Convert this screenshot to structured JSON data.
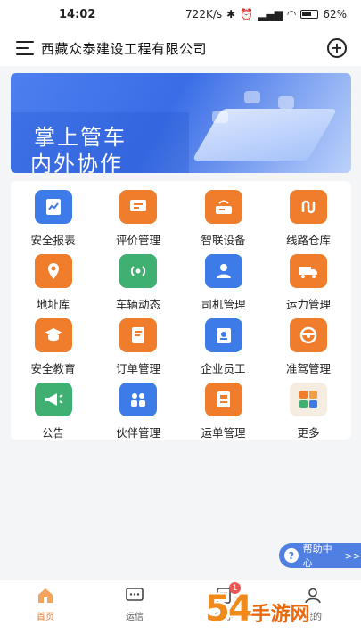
{
  "status_bar": {
    "time": "14:02",
    "speed": "722K/s",
    "battery": "62"
  },
  "header": {
    "title": "西藏众泰建设工程有限公司"
  },
  "banner": {
    "line1": "掌上管车",
    "line2": "内外协作"
  },
  "grid": [
    {
      "label": "安全报表",
      "icon": "report-chart-icon",
      "color": "#3d7be8"
    },
    {
      "label": "评价管理",
      "icon": "comment-icon",
      "color": "#f07d2c"
    },
    {
      "label": "智联设备",
      "icon": "device-signal-icon",
      "color": "#f07d2c"
    },
    {
      "label": "线路仓库",
      "icon": "route-icon",
      "color": "#f07d2c"
    },
    {
      "label": "地址库",
      "icon": "location-pin-icon",
      "color": "#f07d2c"
    },
    {
      "label": "车辆动态",
      "icon": "broadcast-icon",
      "color": "#3fb072"
    },
    {
      "label": "司机管理",
      "icon": "driver-icon",
      "color": "#3d7be8"
    },
    {
      "label": "运力管理",
      "icon": "truck-icon",
      "color": "#f07d2c"
    },
    {
      "label": "安全教育",
      "icon": "graduation-cap-icon",
      "color": "#f07d2c"
    },
    {
      "label": "订单管理",
      "icon": "order-icon",
      "color": "#f07d2c"
    },
    {
      "label": "企业员工",
      "icon": "badge-icon",
      "color": "#3d7be8"
    },
    {
      "label": "准驾管理",
      "icon": "steering-wheel-icon",
      "color": "#f07d2c"
    },
    {
      "label": "公告",
      "icon": "megaphone-icon",
      "color": "#3fb072"
    },
    {
      "label": "伙伴管理",
      "icon": "partners-icon",
      "color": "#3d7be8"
    },
    {
      "label": "运单管理",
      "icon": "waybill-icon",
      "color": "#f07d2c"
    },
    {
      "label": "更多",
      "icon": "more-apps-icon",
      "color": "#f5ede2"
    }
  ],
  "help": {
    "label": "帮助中心",
    "arrow": ">>"
  },
  "tabs": [
    {
      "label": "首页",
      "icon": "home-icon"
    },
    {
      "label": "运信",
      "icon": "message-icon"
    },
    {
      "label": "待办",
      "icon": "todo-icon",
      "badge": "1"
    },
    {
      "label": "我的",
      "icon": "user-icon"
    }
  ],
  "watermark": {
    "text": "54",
    "sub": "手游网"
  }
}
